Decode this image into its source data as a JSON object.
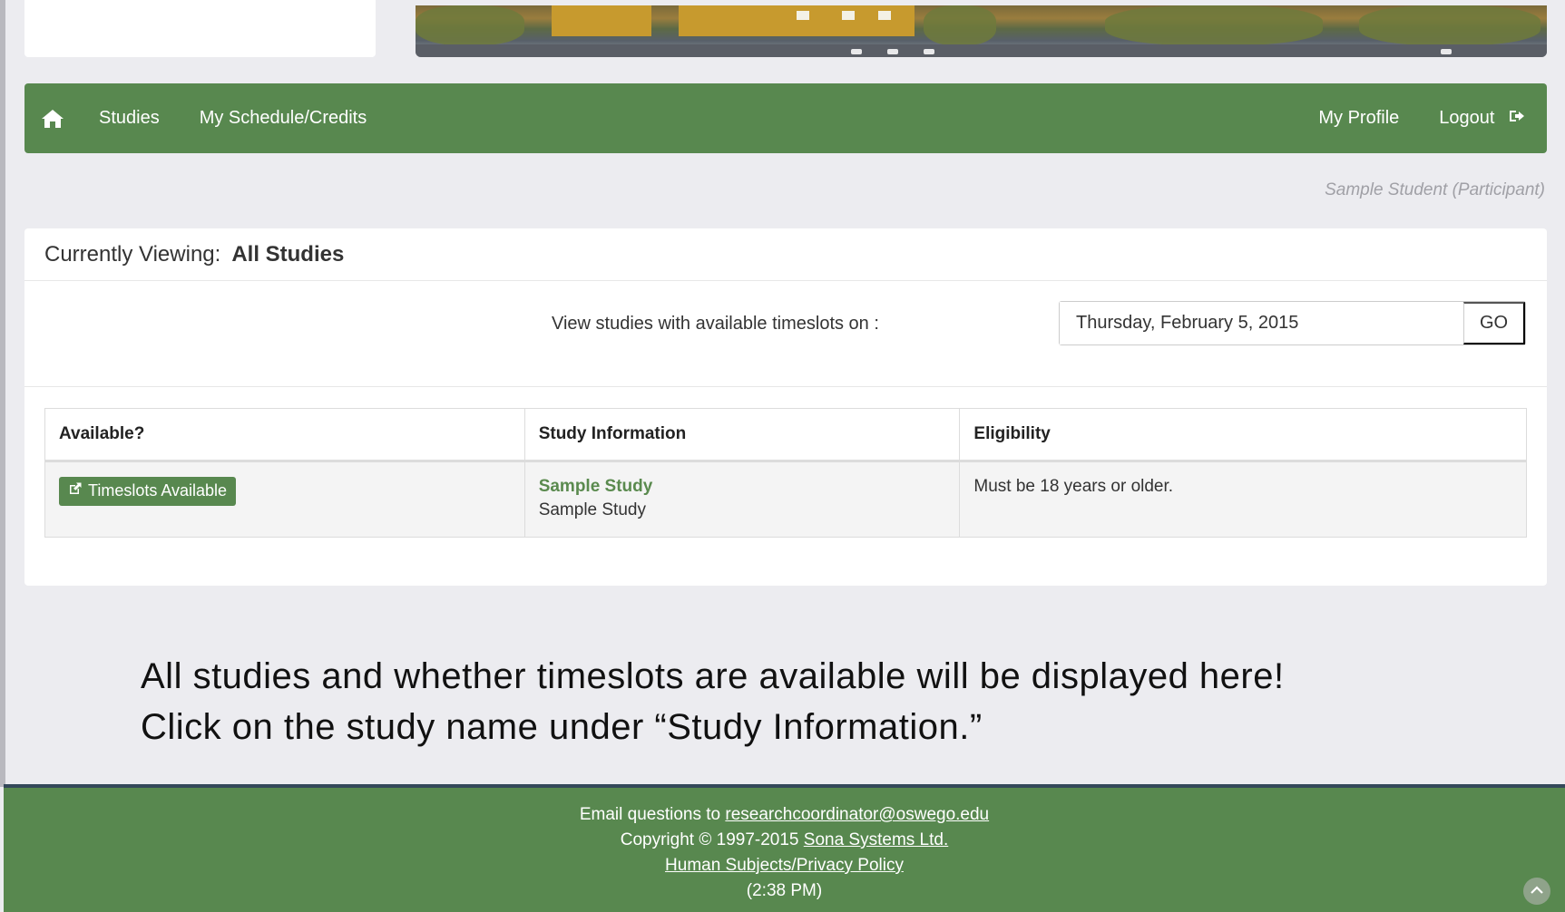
{
  "nav": {
    "home_icon": "home-icon",
    "studies": "Studies",
    "schedule": "My Schedule/Credits",
    "profile": "My Profile",
    "logout": "Logout",
    "logout_icon": "logout-icon"
  },
  "user_label": "Sample Student (Participant)",
  "panel": {
    "currently_viewing_label": "Currently Viewing:",
    "currently_viewing_value": "All Studies",
    "date_label": "View studies with available timeslots on :",
    "date_value": "Thursday, February 5, 2015",
    "go_label": "GO"
  },
  "table": {
    "headers": [
      "Available?",
      "Study Information",
      "Eligibility"
    ],
    "rows": [
      {
        "available": "Timeslots Available",
        "study_name": "Sample Study",
        "study_description": "Sample Study",
        "eligibility": "Must be 18 years or older."
      }
    ]
  },
  "caption": {
    "line1": "All studies and whether timeslots are available will be displayed here!",
    "line2": "Click on the study name under “Study Information.”"
  },
  "footer": {
    "email_prefix": "Email questions to",
    "email": "researchcoordinator@oswego.edu",
    "copyright_prefix": "Copyright © 1997-2015",
    "company": "Sona Systems Ltd.",
    "policy": "Human Subjects/Privacy Policy",
    "time": "(2:38 PM)"
  },
  "colors": {
    "brand_green": "#58884f",
    "footer_rule": "#34485a",
    "study_link": "#5a8a4e"
  }
}
